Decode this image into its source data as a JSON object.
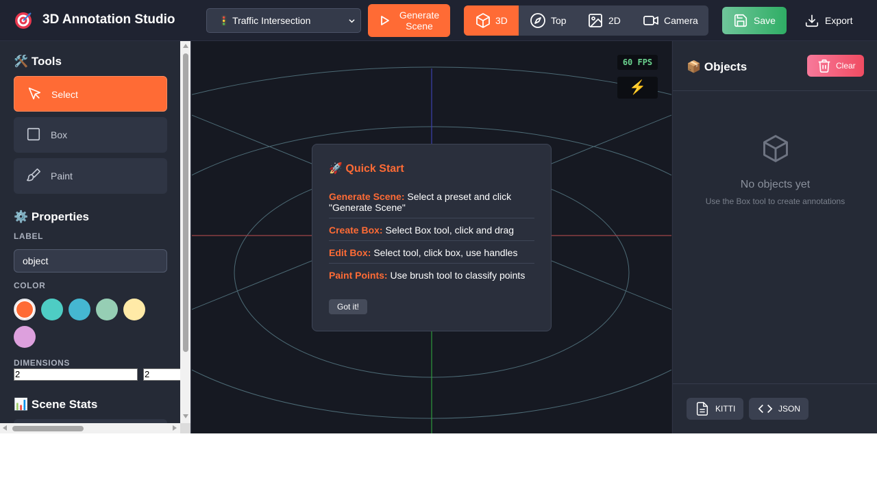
{
  "app": {
    "title": "3D Annotation Studio",
    "logo_icon": "target-icon"
  },
  "header": {
    "preset": {
      "selected": "🚦 Traffic Intersection"
    },
    "generate_label": "Generate Scene",
    "view_modes": [
      {
        "label": "3D",
        "icon": "cube-icon",
        "active": true
      },
      {
        "label": "Top",
        "icon": "compass-icon",
        "active": false
      },
      {
        "label": "2D",
        "icon": "image-icon",
        "active": false
      },
      {
        "label": "Camera",
        "icon": "video-camera-icon",
        "active": false
      }
    ],
    "save_label": "Save",
    "export_label": "Export"
  },
  "tools": {
    "title": "🛠️ Tools",
    "items": [
      {
        "label": "Select",
        "icon": "cursor-icon",
        "active": true
      },
      {
        "label": "Box",
        "icon": "square-icon",
        "active": false
      },
      {
        "label": "Paint",
        "icon": "brush-icon",
        "active": false
      }
    ]
  },
  "properties": {
    "title": "⚙️ Properties",
    "label_caption": "LABEL",
    "label_value": "object",
    "color_caption": "COLOR",
    "colors": [
      "#ff6b35",
      "#4ecdc4",
      "#45b7d1",
      "#96ceb4",
      "#ffeaa7",
      "#dda0dd"
    ],
    "selected_color_index": 0,
    "dimensions_caption": "DIMENSIONS",
    "dimensions": [
      "2",
      "2"
    ]
  },
  "stats": {
    "title": "📊 Scene Stats"
  },
  "viewport": {
    "fps": "60 FPS",
    "perf_icon": "⚡"
  },
  "quick_start": {
    "title": "🚀 Quick Start",
    "items": [
      {
        "key": "Generate Scene:",
        "text": " Select a preset and click \"Generate Scene\""
      },
      {
        "key": "Create Box:",
        "text": " Select Box tool, click and drag"
      },
      {
        "key": "Edit Box:",
        "text": " Select tool, click box, use handles"
      },
      {
        "key": "Paint Points:",
        "text": " Use brush tool to classify points"
      }
    ],
    "dismiss_label": "Got it!"
  },
  "objects": {
    "title": "📦 Objects",
    "clear_label": "Clear",
    "empty_title": "No objects yet",
    "empty_subtitle": "Use the Box tool to create annotations",
    "export_buttons": [
      {
        "label": "KITTI",
        "icon": "file-icon"
      },
      {
        "label": "JSON",
        "icon": "code-icon"
      }
    ]
  }
}
